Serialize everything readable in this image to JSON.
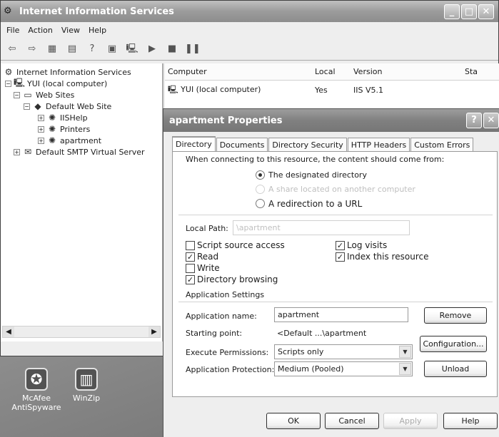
{
  "iis_window": {
    "title": "Internet Information Services",
    "menu": [
      "File",
      "Action",
      "View",
      "Help"
    ],
    "tree": {
      "root": "Internet Information Services",
      "computer": "YUI (local computer)",
      "web_sites": "Web Sites",
      "default_web_site": "Default Web Site",
      "children": [
        "IISHelp",
        "Printers",
        "apartment"
      ],
      "smtp": "Default SMTP Virtual Server"
    },
    "list": {
      "headers": [
        "Computer",
        "Local",
        "Version",
        "Sta"
      ],
      "rows": [
        {
          "computer": "YUI (local computer)",
          "local": "Yes",
          "version": "IIS V5.1",
          "status": ""
        }
      ]
    }
  },
  "desktop": {
    "icons": [
      {
        "label": "McAfee AntiSpyware",
        "icon": "mcafee-icon"
      },
      {
        "label": "WinZip",
        "icon": "winzip-icon"
      }
    ]
  },
  "dialog": {
    "title": "apartment Properties",
    "tabs": [
      "Directory",
      "Documents",
      "Directory Security",
      "HTTP Headers",
      "Custom Errors"
    ],
    "active_tab": "Directory",
    "intro": "When connecting to this resource, the content should come from:",
    "source_options": [
      {
        "label": "The designated directory",
        "checked": true,
        "enabled": true
      },
      {
        "label": "A share located on another computer",
        "checked": false,
        "enabled": false
      },
      {
        "label": "A redirection to a URL",
        "checked": false,
        "enabled": true
      }
    ],
    "local_path_label": "Local Path:",
    "local_path_value": "\\apartment",
    "checkboxes_left": [
      {
        "label": "Script source access",
        "checked": false
      },
      {
        "label": "Read",
        "checked": true
      },
      {
        "label": "Write",
        "checked": false
      },
      {
        "label": "Directory browsing",
        "checked": true
      }
    ],
    "checkboxes_right": [
      {
        "label": "Log visits",
        "checked": true
      },
      {
        "label": "Index this resource",
        "checked": true
      }
    ],
    "app_settings_label": "Application Settings",
    "app_name_label": "Application name:",
    "app_name_value": "apartment",
    "starting_point_label": "Starting point:",
    "starting_point_value": "<Default ...\\apartment",
    "exec_perm_label": "Execute Permissions:",
    "exec_perm_value": "Scripts only",
    "app_protection_label": "Application Protection:",
    "app_protection_value": "Medium (Pooled)",
    "buttons": {
      "remove": "Remove",
      "configuration": "Configuration...",
      "unload": "Unload",
      "ok": "OK",
      "cancel": "Cancel",
      "apply": "Apply",
      "help": "Help"
    }
  }
}
